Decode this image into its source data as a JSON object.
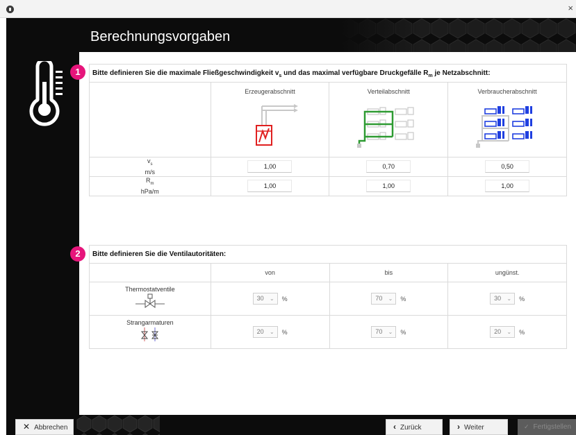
{
  "window": {
    "close_glyph": "×"
  },
  "header": {
    "title": "Berechnungsvorgaben"
  },
  "section1": {
    "badge": "1",
    "heading_pre": "Bitte definieren Sie die maximale Fließgeschwindigkeit v",
    "heading_sub1": "s",
    "heading_mid": " und das maximal verfügbare Druckgefälle R",
    "heading_sub2": "m",
    "heading_post": " je Netzabschnitt:",
    "columns": [
      "Erzeugerabschnitt",
      "Verteilabschnitt",
      "Verbraucherabschnitt"
    ],
    "rows": [
      {
        "symbol": "v",
        "symbol_sub": "s",
        "unit": "m/s",
        "values": [
          "1,00",
          "0,70",
          "0,50"
        ]
      },
      {
        "symbol": "R",
        "symbol_sub": "m",
        "unit": "hPa/m",
        "values": [
          "1,00",
          "1,00",
          "1,00"
        ]
      }
    ]
  },
  "section2": {
    "badge": "2",
    "heading": "Bitte definieren Sie die Ventilautoritäten:",
    "columns": [
      "von",
      "bis",
      "ungünst."
    ],
    "rows": [
      {
        "label": "Thermostatventile",
        "values": [
          "30",
          "70",
          "30"
        ],
        "unit": "%"
      },
      {
        "label": "Strangarmaturen",
        "values": [
          "20",
          "70",
          "20"
        ],
        "unit": "%"
      }
    ]
  },
  "footer": {
    "cancel_label": "Abbrechen",
    "back_label": "Zurück",
    "next_label": "Weiter",
    "finish_label": "Fertigstellen"
  },
  "colors": {
    "accent_badge": "#e6157b",
    "frame": "#0c0c0c",
    "pipe_green": "#2e9b32",
    "consumer_blue": "#1f3fe0",
    "generator_red": "#e02020"
  },
  "icons": [
    "app-icon",
    "close-icon",
    "thermometer-icon",
    "generator-diagram-icon",
    "distribution-diagram-icon",
    "consumer-diagram-icon",
    "thermostat-valve-icon",
    "balancing-valve-icon",
    "chevron-down-icon",
    "cancel-x-icon",
    "chevron-left-icon",
    "chevron-right-icon",
    "check-icon"
  ]
}
